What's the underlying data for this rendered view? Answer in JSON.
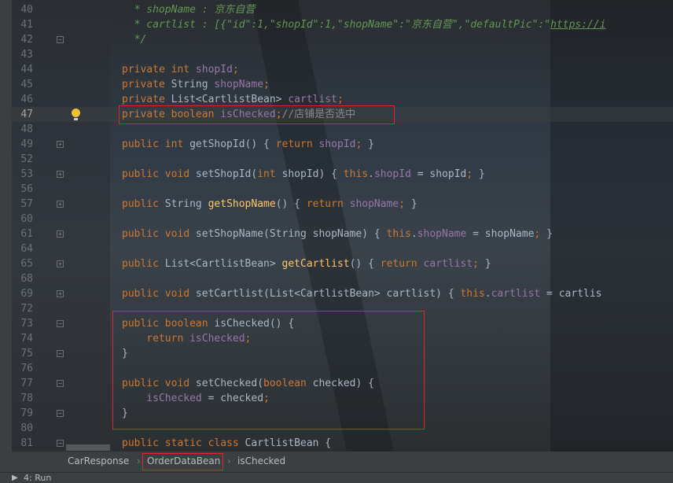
{
  "code": {
    "lines": [
      {
        "n": "40",
        "tokens": [
          {
            "t": "  * shopName : 京东自营",
            "k": "comment"
          }
        ]
      },
      {
        "n": "41",
        "tokens": [
          {
            "t": "  * cartlist : [{\"id\":1,\"shopId\":1,\"shopName\":\"京东自营\",\"defaultPic\":\"",
            "k": "comment"
          },
          {
            "t": "https://i",
            "k": "url"
          }
        ]
      },
      {
        "n": "42",
        "fold": "minus",
        "tokens": [
          {
            "t": "  */",
            "k": "comment"
          }
        ]
      },
      {
        "n": "43",
        "tokens": []
      },
      {
        "n": "44",
        "tokens": [
          {
            "t": "private int ",
            "k": "keyword"
          },
          {
            "t": "shopId",
            "k": "field"
          },
          {
            "t": ";",
            "k": "keyword"
          }
        ]
      },
      {
        "n": "45",
        "tokens": [
          {
            "t": "private ",
            "k": "keyword"
          },
          {
            "t": "String ",
            "k": "type"
          },
          {
            "t": "shopName",
            "k": "field"
          },
          {
            "t": ";",
            "k": "keyword"
          }
        ]
      },
      {
        "n": "46",
        "tokens": [
          {
            "t": "private ",
            "k": "keyword"
          },
          {
            "t": "List<CartlistBean> ",
            "k": "type"
          },
          {
            "t": "cartlist",
            "k": "field"
          },
          {
            "t": ";",
            "k": "keyword"
          }
        ]
      },
      {
        "n": "47",
        "current": true,
        "bulb": true,
        "tokens": [
          {
            "t": "private boolean ",
            "k": "keyword"
          },
          {
            "t": "isChecked",
            "k": "field"
          },
          {
            "t": ";",
            "k": "keyword"
          },
          {
            "t": "//店铺是否选中",
            "k": "linecomment"
          }
        ]
      },
      {
        "n": "48",
        "tokens": []
      },
      {
        "n": "49",
        "fold": "plus",
        "tokens": [
          {
            "t": "public int ",
            "k": "keyword"
          },
          {
            "t": "getShopId",
            "k": "plain"
          },
          {
            "t": "() { ",
            "k": "plain"
          },
          {
            "t": "return ",
            "k": "keyword"
          },
          {
            "t": "shopId",
            "k": "field"
          },
          {
            "t": "; ",
            "k": "keyword"
          },
          {
            "t": "}",
            "k": "plain"
          }
        ]
      },
      {
        "n": "52",
        "tokens": []
      },
      {
        "n": "53",
        "fold": "plus",
        "tokens": [
          {
            "t": "public void ",
            "k": "keyword"
          },
          {
            "t": "setShopId",
            "k": "plain"
          },
          {
            "t": "(",
            "k": "plain"
          },
          {
            "t": "int ",
            "k": "keyword"
          },
          {
            "t": "shopId) { ",
            "k": "plain"
          },
          {
            "t": "this",
            "k": "keyword"
          },
          {
            "t": ".",
            "k": "plain"
          },
          {
            "t": "shopId",
            "k": "field"
          },
          {
            "t": " = shopId",
            "k": "plain"
          },
          {
            "t": "; ",
            "k": "keyword"
          },
          {
            "t": "}",
            "k": "plain"
          }
        ]
      },
      {
        "n": "56",
        "tokens": []
      },
      {
        "n": "57",
        "fold": "plus",
        "tokens": [
          {
            "t": "public ",
            "k": "keyword"
          },
          {
            "t": "String ",
            "k": "type"
          },
          {
            "t": "getShopName",
            "k": "method"
          },
          {
            "t": "() { ",
            "k": "plain"
          },
          {
            "t": "return ",
            "k": "keyword"
          },
          {
            "t": "shopName",
            "k": "field"
          },
          {
            "t": "; ",
            "k": "keyword"
          },
          {
            "t": "}",
            "k": "plain"
          }
        ]
      },
      {
        "n": "60",
        "tokens": []
      },
      {
        "n": "61",
        "fold": "plus",
        "tokens": [
          {
            "t": "public void ",
            "k": "keyword"
          },
          {
            "t": "setShopName",
            "k": "plain"
          },
          {
            "t": "(String shopName) { ",
            "k": "plain"
          },
          {
            "t": "this",
            "k": "keyword"
          },
          {
            "t": ".",
            "k": "plain"
          },
          {
            "t": "shopName",
            "k": "field"
          },
          {
            "t": " = shopName",
            "k": "plain"
          },
          {
            "t": "; ",
            "k": "keyword"
          },
          {
            "t": "}",
            "k": "plain"
          }
        ]
      },
      {
        "n": "64",
        "tokens": []
      },
      {
        "n": "65",
        "fold": "plus",
        "tokens": [
          {
            "t": "public ",
            "k": "keyword"
          },
          {
            "t": "List<CartlistBean> ",
            "k": "type"
          },
          {
            "t": "getCartlist",
            "k": "method"
          },
          {
            "t": "() { ",
            "k": "plain"
          },
          {
            "t": "return ",
            "k": "keyword"
          },
          {
            "t": "cartlist",
            "k": "field"
          },
          {
            "t": "; ",
            "k": "keyword"
          },
          {
            "t": "}",
            "k": "plain"
          }
        ]
      },
      {
        "n": "68",
        "tokens": []
      },
      {
        "n": "69",
        "fold": "plus",
        "tokens": [
          {
            "t": "public void ",
            "k": "keyword"
          },
          {
            "t": "setCartlist",
            "k": "plain"
          },
          {
            "t": "(List<CartlistBean> cartlist) { ",
            "k": "plain"
          },
          {
            "t": "this",
            "k": "keyword"
          },
          {
            "t": ".",
            "k": "plain"
          },
          {
            "t": "cartlist",
            "k": "field"
          },
          {
            "t": " = cartlis",
            "k": "plain"
          }
        ]
      },
      {
        "n": "72",
        "tokens": []
      },
      {
        "n": "73",
        "fold": "minus",
        "tokens": [
          {
            "t": "public boolean ",
            "k": "keyword"
          },
          {
            "t": "isChecked",
            "k": "plain"
          },
          {
            "t": "() {",
            "k": "plain"
          }
        ]
      },
      {
        "n": "74",
        "tokens": [
          {
            "t": "    return ",
            "k": "keyword"
          },
          {
            "t": "isChecked",
            "k": "field"
          },
          {
            "t": ";",
            "k": "keyword"
          }
        ]
      },
      {
        "n": "75",
        "fold": "minus",
        "tokens": [
          {
            "t": "}",
            "k": "plain"
          }
        ]
      },
      {
        "n": "76",
        "tokens": []
      },
      {
        "n": "77",
        "fold": "minus",
        "tokens": [
          {
            "t": "public void ",
            "k": "keyword"
          },
          {
            "t": "setChecked",
            "k": "plain"
          },
          {
            "t": "(",
            "k": "plain"
          },
          {
            "t": "boolean ",
            "k": "keyword"
          },
          {
            "t": "checked) {",
            "k": "plain"
          }
        ]
      },
      {
        "n": "78",
        "tokens": [
          {
            "t": "    isChecked",
            "k": "field"
          },
          {
            "t": " = checked",
            "k": "plain"
          },
          {
            "t": ";",
            "k": "keyword"
          }
        ]
      },
      {
        "n": "79",
        "fold": "minus",
        "tokens": [
          {
            "t": "}",
            "k": "plain"
          }
        ]
      },
      {
        "n": "80",
        "tokens": []
      },
      {
        "n": "81",
        "fold": "minus",
        "tokens": [
          {
            "t": "public static class ",
            "k": "keyword"
          },
          {
            "t": "CartlistBean {",
            "k": "plain"
          }
        ]
      }
    ]
  },
  "breadcrumb": [
    "CarResponse",
    "OrderDataBean",
    "isChecked"
  ],
  "breadcrumb_separator": "›",
  "bottom_bar": {
    "run_label": "4: Run"
  },
  "colors": {
    "highlight_box": "#e0262a",
    "keyword": "#cc7832",
    "field": "#9876aa",
    "comment": "#629755",
    "method": "#ffc66d"
  }
}
